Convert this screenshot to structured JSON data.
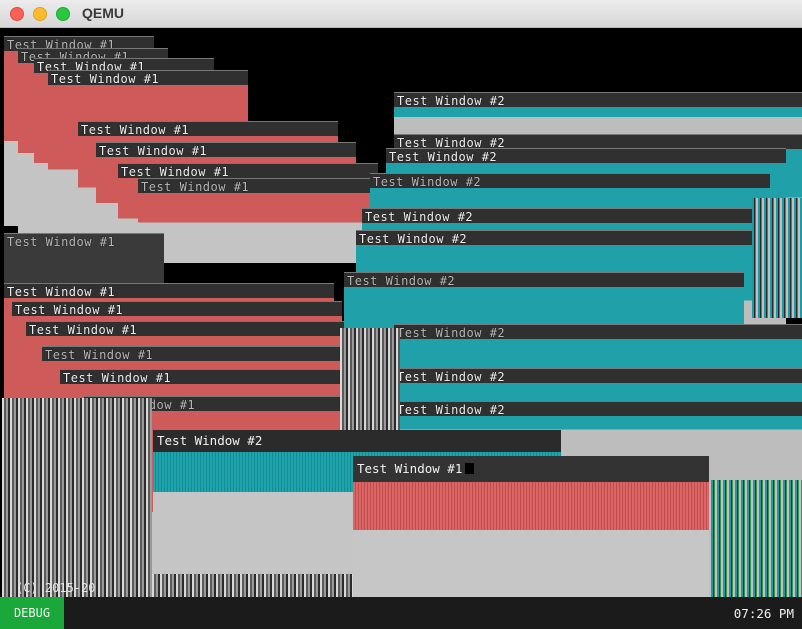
{
  "window": {
    "app_title": "QEMU"
  },
  "windows": {
    "test1": "Test Window #1",
    "test2": "Test Window #2"
  },
  "footer": {
    "copyright": "(C) 2015-20",
    "debug_label": "DEBUG",
    "clock": "07:26 PM"
  },
  "colors": {
    "window1_accent": "#d95f5f",
    "window2_accent": "#1ea4ad",
    "body_gray": "#c5c5c5",
    "taskbar": "#1b1b1b",
    "debug_green": "#1aa83b"
  }
}
